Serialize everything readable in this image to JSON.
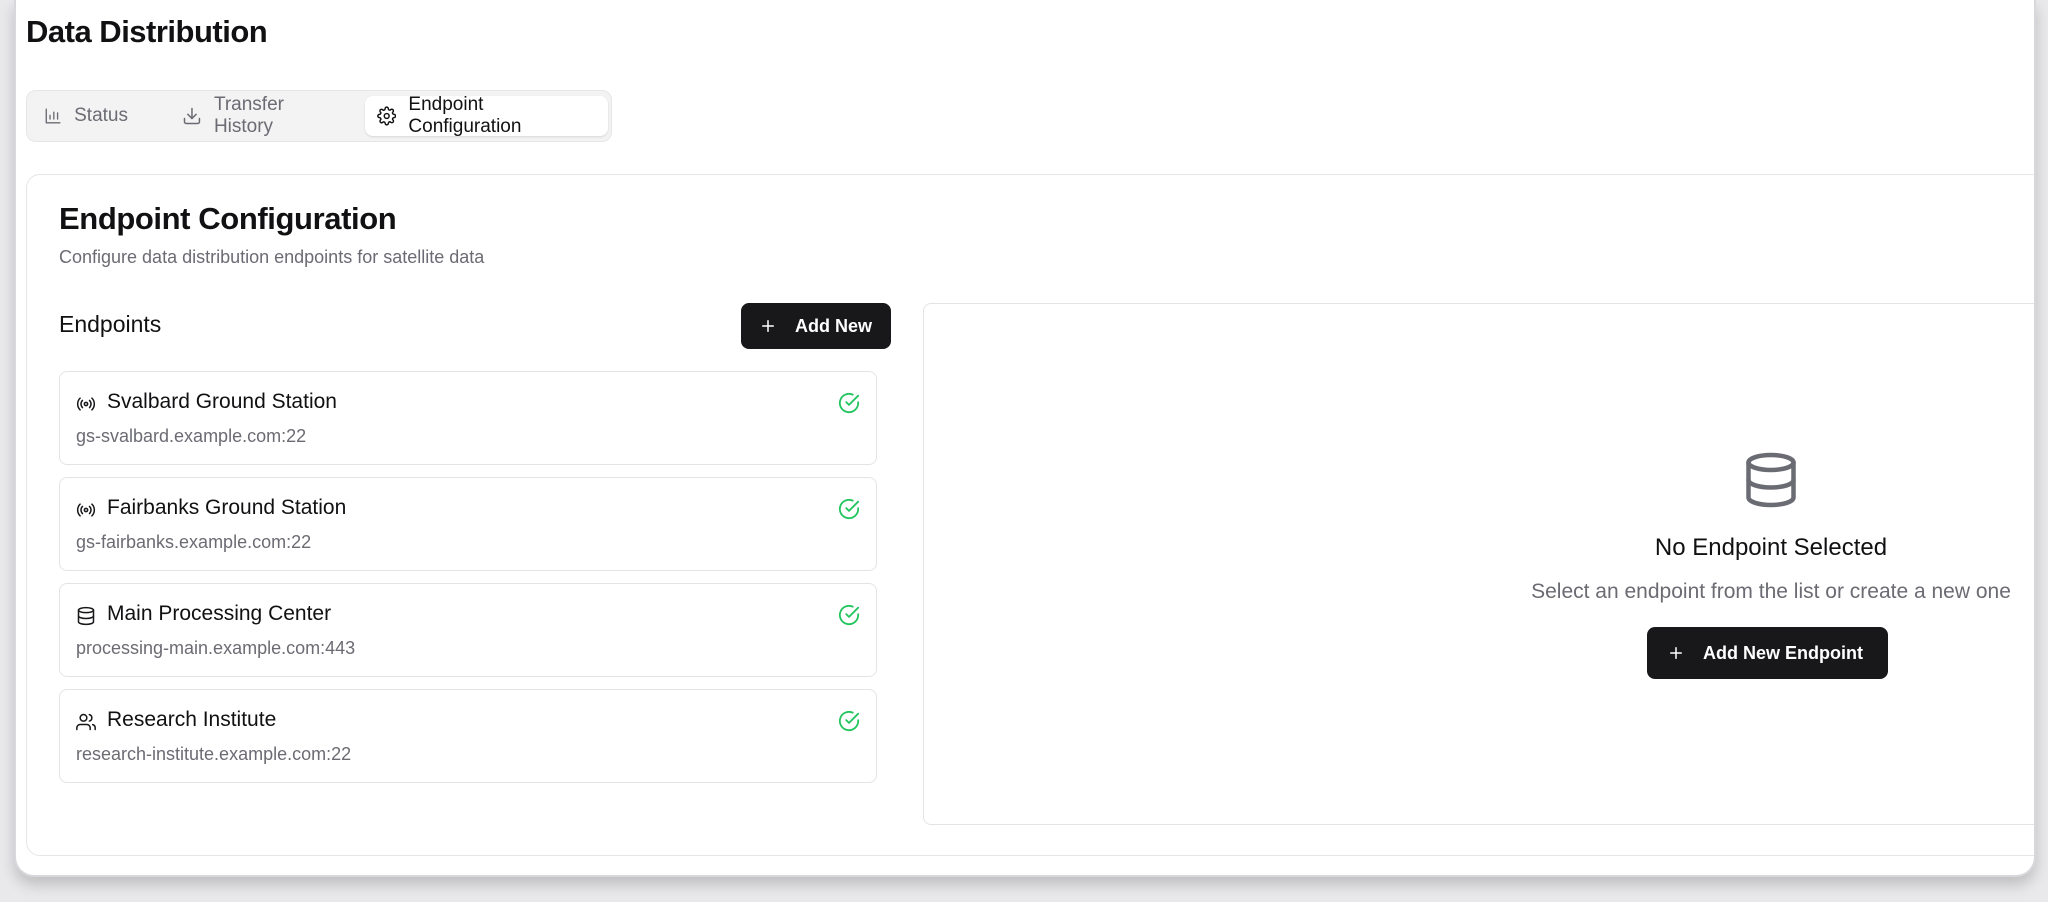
{
  "page": {
    "title": "Data Distribution"
  },
  "tabs": [
    {
      "label": "Status",
      "icon": "bar-chart-icon",
      "active": false
    },
    {
      "label": "Transfer History",
      "icon": "download-icon",
      "active": false
    },
    {
      "label": "Endpoint Configuration",
      "icon": "gear-icon",
      "active": true
    }
  ],
  "section": {
    "title": "Endpoint Configuration",
    "subtitle": "Configure data distribution endpoints for satellite data"
  },
  "endpoints": {
    "title": "Endpoints",
    "add_label": "Add New",
    "items": [
      {
        "name": "Svalbard Ground Station",
        "host": "gs-svalbard.example.com:22",
        "icon": "radio-antenna-icon",
        "status": "active"
      },
      {
        "name": "Fairbanks Ground Station",
        "host": "gs-fairbanks.example.com:22",
        "icon": "radio-antenna-icon",
        "status": "active"
      },
      {
        "name": "Main Processing Center",
        "host": "processing-main.example.com:443",
        "icon": "database-icon",
        "status": "active"
      },
      {
        "name": "Research Institute",
        "host": "research-institute.example.com:22",
        "icon": "users-icon",
        "status": "active"
      }
    ]
  },
  "detail": {
    "empty_title": "No Endpoint Selected",
    "empty_subtitle": "Select an endpoint from the list or create a new one",
    "add_button_label": "Add New Endpoint",
    "icon": "database-icon"
  },
  "colors": {
    "primary_button": "#18181b",
    "status_ok": "#22c55e",
    "muted_text": "#6b6b73"
  }
}
